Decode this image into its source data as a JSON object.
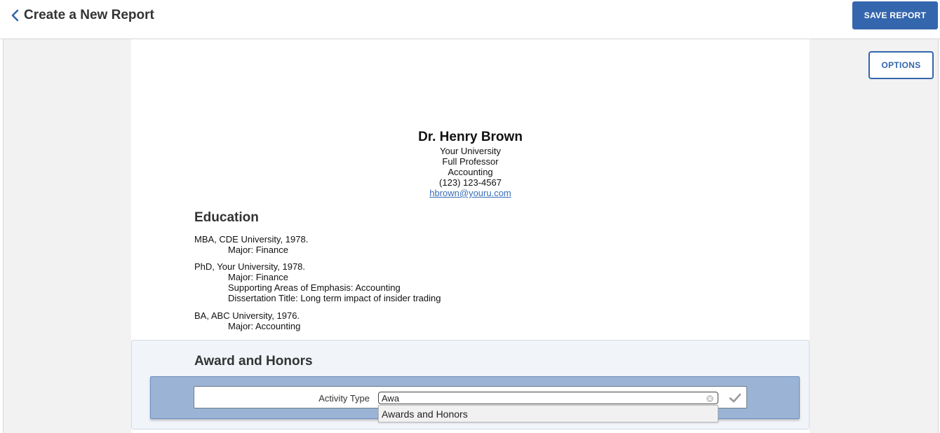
{
  "header": {
    "title": "Create a New Report",
    "save_label": "SAVE REPORT",
    "back_icon": "chevron-left-icon"
  },
  "toolbar": {
    "options_label": "OPTIONS"
  },
  "profile": {
    "name": "Dr. Henry Brown",
    "university": "Your University",
    "rank": "Full Professor",
    "department": "Accounting",
    "phone": "(123) 123-4567",
    "email": "hbrown@youru.com"
  },
  "education": {
    "title": "Education",
    "entries": [
      {
        "degree": "MBA, CDE University, 1978.",
        "details": [
          "Major: Finance"
        ]
      },
      {
        "degree": "PhD, Your University, 1978.",
        "details": [
          "Major: Finance",
          "Supporting Areas of Emphasis: Accounting",
          "Dissertation Title: Long term impact of insider trading"
        ]
      },
      {
        "degree": "BA, ABC University, 1976.",
        "details": [
          "Major: Accounting"
        ]
      }
    ]
  },
  "awards": {
    "title": "Award and Honors",
    "filter": {
      "label": "Activity Type",
      "value": "Awa",
      "suggestion": "Awards and Honors"
    }
  },
  "colors": {
    "primary": "#3466ad",
    "link": "#3a6fb7",
    "filter_band": "#9bb4d6"
  }
}
